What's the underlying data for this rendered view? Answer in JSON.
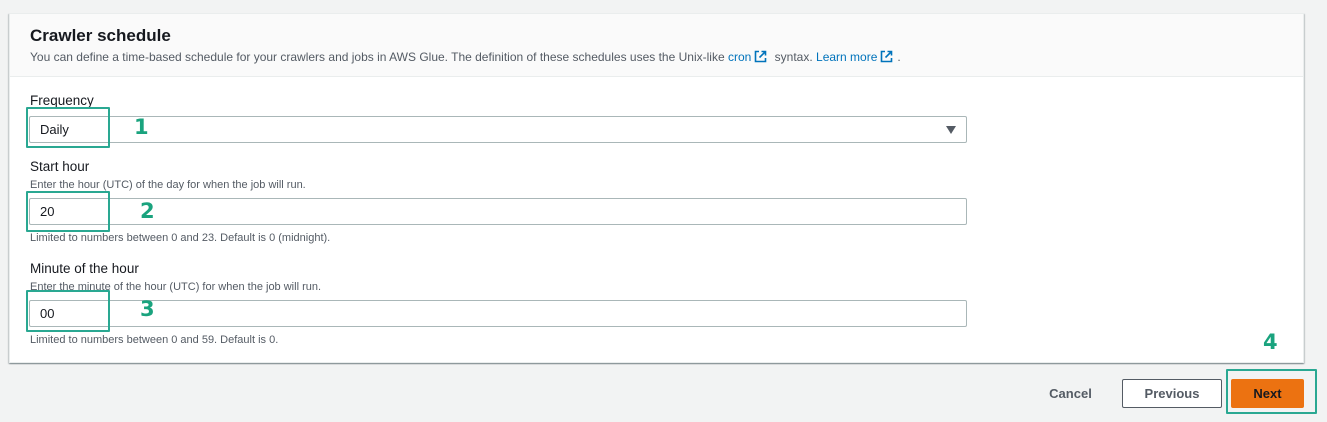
{
  "section": {
    "title": "Crawler schedule",
    "description_before": "You can define a time-based schedule for your crawlers and jobs in AWS Glue. The definition of these schedules uses the Unix-like",
    "cron_link": "cron",
    "description_middle": "syntax.",
    "learn_more_link": "Learn more",
    "description_end": "."
  },
  "frequency": {
    "label": "Frequency",
    "selected": "Daily"
  },
  "start_hour": {
    "label": "Start hour",
    "description": "Enter the hour (UTC) of the day for when the job will run.",
    "value": "20",
    "constraint": "Limited to numbers between 0 and 23. Default is 0 (midnight)."
  },
  "minute": {
    "label": "Minute of the hour",
    "description": "Enter the minute of the hour (UTC) for when the job will run.",
    "value": "00",
    "constraint": "Limited to numbers between 0 and 59. Default is 0."
  },
  "annotations": {
    "step1": "1",
    "step2": "2",
    "step3": "3",
    "step4": "4"
  },
  "footer": {
    "cancel_label": "Cancel",
    "previous_label": "Previous",
    "next_label": "Next"
  },
  "colors": {
    "accent": "#ec7211",
    "link": "#0073bb",
    "annotation": "#1aa37e"
  },
  "icons": [
    "external-link-icon",
    "caret-down-icon"
  ]
}
